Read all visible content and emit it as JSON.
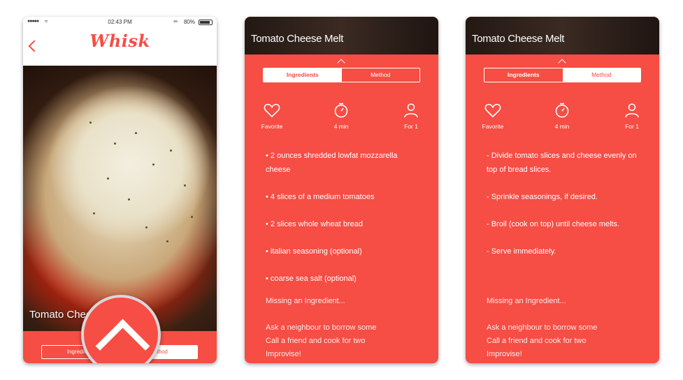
{
  "screen1": {
    "status": {
      "signal": "●●●●●",
      "time": "02:43 PM",
      "battery": "80%"
    },
    "app_name": "Whisk",
    "photo_title": "Tomato Cheese Melt",
    "tabs": [
      "Ingredients",
      "Method"
    ]
  },
  "screen2": {
    "title": "Tomato Cheese Melt",
    "tabs": {
      "left": "Ingredients",
      "right": "Method"
    },
    "meta": {
      "favorite": "Favorite",
      "time": "4 min",
      "serves": "For 1"
    },
    "ingredients": [
      "• 2 ounces shredded lowfat mozzarella cheese",
      "• 4 slices of a medium tomatoes",
      "• 2 slices whole wheat bread",
      "• italian seasoning (optional)",
      "• coarse sea salt (optional)"
    ],
    "missing": "Missing an Ingredient...",
    "tips": [
      "Ask a neighbour to borrow some",
      "Call a friend and cook for two",
      "Improvise!"
    ]
  },
  "screen3": {
    "title": "Tomato Cheese Melt",
    "tabs": {
      "left": "Ingredients",
      "right": "Method"
    },
    "meta": {
      "favorite": "Favorite",
      "time": "4 min",
      "serves": "For 1"
    },
    "method": [
      "- Divide tomato slices and cheese evenly on top of bread slices.",
      "- Sprinkle seasonings, if desired.",
      "- Broil (cook on top) until cheese melts.",
      "- Serve immediately."
    ],
    "missing": "Missing an Ingredient...",
    "tips": [
      "Ask a neighbour to borrow some",
      "Call a friend and cook for two",
      "Improvise!"
    ]
  },
  "colors": {
    "accent": "#f64d44",
    "header_dark": "#2b1e18"
  }
}
